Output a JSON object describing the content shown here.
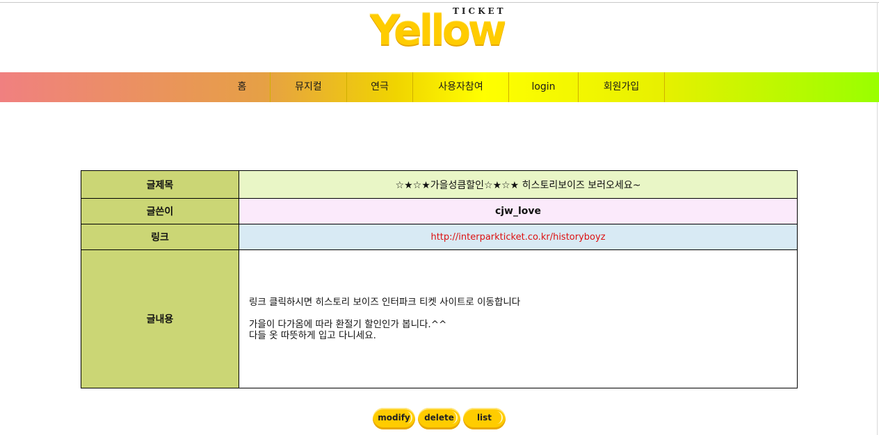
{
  "logo": {
    "ticket": "TICKET",
    "word": "Yellow"
  },
  "nav": [
    {
      "label": "홈"
    },
    {
      "label": "뮤지컬"
    },
    {
      "label": "연극"
    },
    {
      "label": "사용자참여"
    },
    {
      "label": "login"
    },
    {
      "label": "회원가입"
    }
  ],
  "post": {
    "title_label": "글제목",
    "title": "☆★☆★가을성큼할인☆★☆★ 히스토리보이즈 보러오세요~",
    "author_label": "글쓴이",
    "author": "cjw_love",
    "link_label": "링크",
    "link": "http://interparkticket.co.kr/historyboyz",
    "content_label": "글내용",
    "content": [
      "링크 클릭하시면 히스토리 보이즈 인터파크 티켓 사이트로 이동합니다",
      "가을이 다가옴에 따라 환절기 할인인가 봅니다.^^",
      "다들 옷 따뜻하게 입고 다니세요."
    ]
  },
  "buttons": {
    "modify": "modify",
    "delete": "delete",
    "list": "list"
  },
  "colors": {
    "label_bg": "#cbd675",
    "title_bg": "#e9f6c6",
    "author_bg": "#fbeafb",
    "link_bg": "#d8eaf4",
    "button": "#ffcc00",
    "link_text": "#dd1111"
  }
}
